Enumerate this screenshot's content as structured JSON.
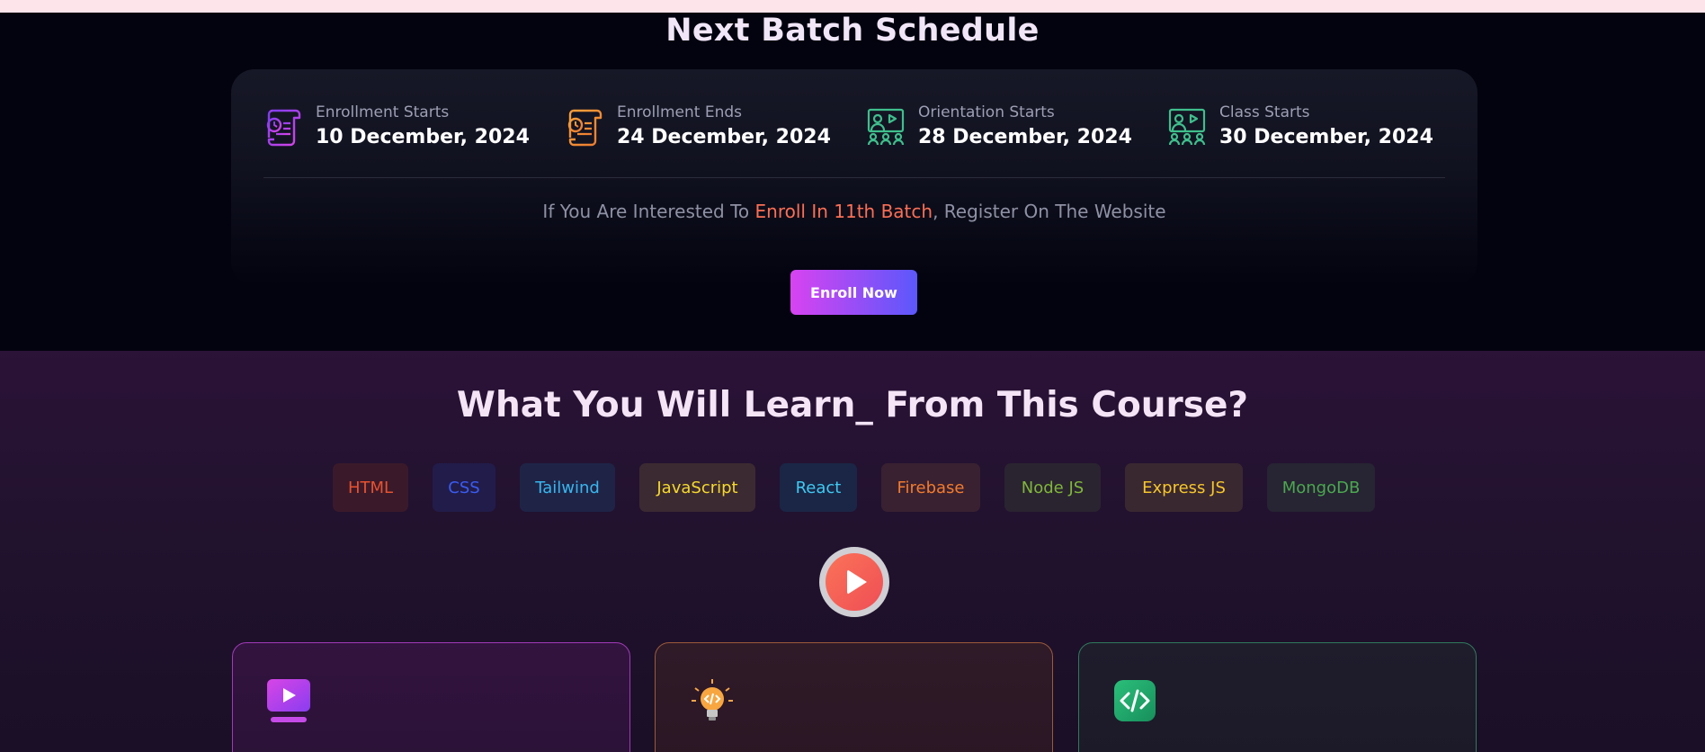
{
  "colors": {
    "accent_orange": "#fb6f55",
    "button_gradient_start": "#d843f1",
    "button_gradient_end": "#5b58fb"
  },
  "batch": {
    "title": "Next Batch Schedule",
    "schedule": [
      {
        "label": "Enrollment Starts",
        "date": "10 December, 2024",
        "icon": "scroll-calendar-icon",
        "color": "#a845e6"
      },
      {
        "label": "Enrollment Ends",
        "date": "24 December, 2024",
        "icon": "scroll-calendar-icon",
        "color": "#f0913b"
      },
      {
        "label": "Orientation Starts",
        "date": "28 December, 2024",
        "icon": "video-class-icon",
        "color": "#3fbf8c"
      },
      {
        "label": "Class Starts",
        "date": "30 December, 2024",
        "icon": "video-class-icon",
        "color": "#3fbf8c"
      }
    ],
    "register_prefix": "If You Are Interested To ",
    "register_highlight": "Enroll In 11th Batch",
    "register_suffix": ", Register On The Website",
    "enroll_button": "Enroll Now"
  },
  "learn": {
    "title": "What You Will Learn_ From This Course?",
    "tags": [
      {
        "label": "HTML",
        "color": "#e8512f",
        "bg": "#3a1a2a"
      },
      {
        "label": "CSS",
        "color": "#3a5cf1",
        "bg": "#221c4a"
      },
      {
        "label": "Tailwind",
        "color": "#38b6ee",
        "bg": "#1f2447"
      },
      {
        "label": "JavaScript",
        "color": "#f5d92c",
        "bg": "#3c2a32"
      },
      {
        "label": "React",
        "color": "#3fc9f2",
        "bg": "#1b2646"
      },
      {
        "label": "Firebase",
        "color": "#f27b2e",
        "bg": "#392131"
      },
      {
        "label": "Node JS",
        "color": "#7fb63a",
        "bg": "#2a2430"
      },
      {
        "label": "Express JS",
        "color": "#f5c62a",
        "bg": "#3a2831"
      },
      {
        "label": "MongoDB",
        "color": "#4aa84f",
        "bg": "#272433"
      }
    ],
    "play_icon": "play-icon",
    "cards": [
      {
        "icon": "video-lesson-icon",
        "border": "#a03ab8"
      },
      {
        "icon": "lightbulb-code-icon",
        "border": "#9b5a3a"
      },
      {
        "icon": "code-brackets-icon",
        "border": "#2f7a5c"
      }
    ]
  }
}
